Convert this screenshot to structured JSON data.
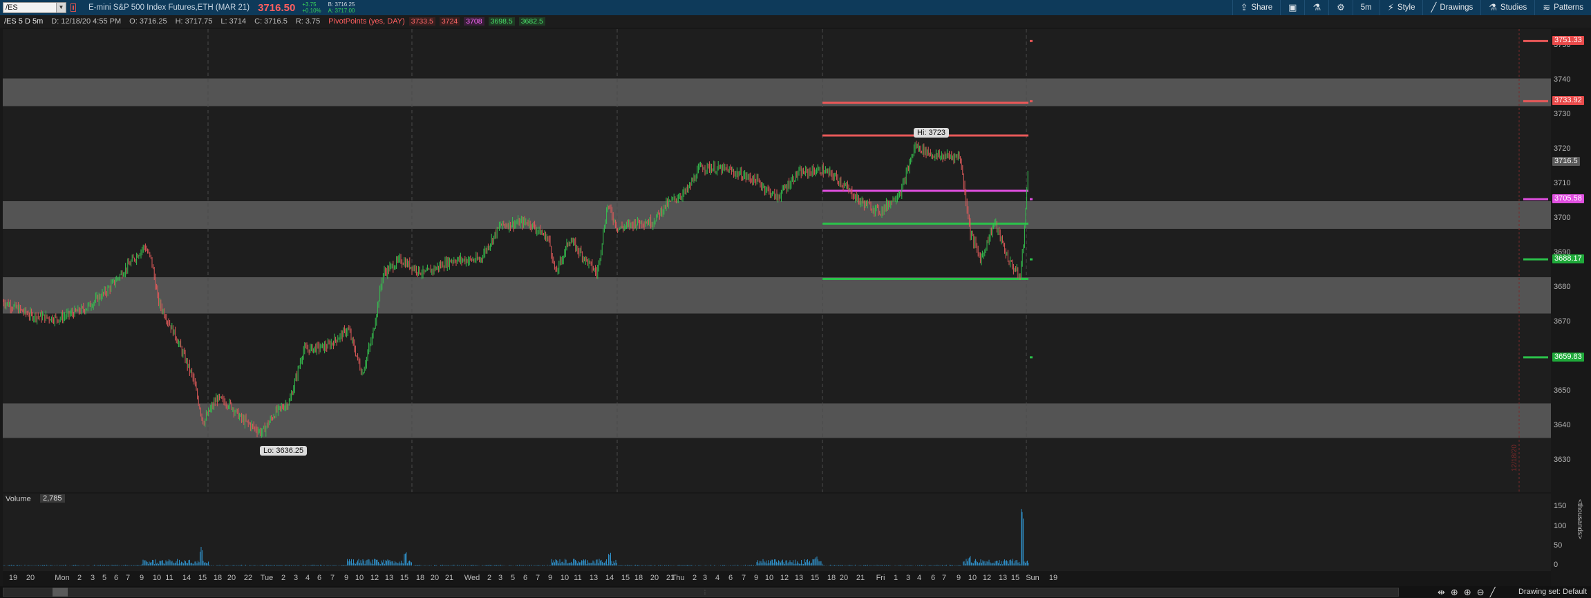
{
  "toolbar": {
    "symbol": "/ES",
    "instrument": "E-mini S&P 500 Index Futures,ETH (MAR 21)",
    "last_price": "3716.50",
    "change": "+3.75",
    "change_pct": "+0.10%",
    "bid": "B: 3716.25",
    "ask": "A: 3717.00",
    "buttons": [
      {
        "label": "Share",
        "icon": "share-icon"
      },
      {
        "label": "",
        "icon": "screenshot-icon"
      },
      {
        "label": "",
        "icon": "flask-icon"
      },
      {
        "label": "",
        "icon": "gear-icon"
      },
      {
        "label": "5m",
        "icon": ""
      },
      {
        "label": "Style",
        "icon": "style-icon"
      },
      {
        "label": "Drawings",
        "icon": "pencil-icon"
      },
      {
        "label": "Studies",
        "icon": "flask-icon"
      },
      {
        "label": "Patterns",
        "icon": "patterns-icon"
      }
    ]
  },
  "info": {
    "symbol_tf": "/ES 5 D 5m",
    "date": "D: 12/18/20 4:55 PM",
    "open": "O: 3716.25",
    "high": "H: 3717.75",
    "low": "L: 3714",
    "close": "C: 3716.5",
    "range": "R: 3.75",
    "pivot_label": "PivotPoints (yes, DAY)",
    "pivot_values": [
      {
        "value": "3733.5",
        "color": "#ff5f5f"
      },
      {
        "value": "3724",
        "color": "#ff5f5f"
      },
      {
        "value": "3708",
        "color": "#ff5cff"
      },
      {
        "value": "3698.5",
        "color": "#3bd55b"
      },
      {
        "value": "3682.5",
        "color": "#3bd55b"
      }
    ]
  },
  "chart": {
    "y_ticks": [
      "3750",
      "3740",
      "3730",
      "3720",
      "3710",
      "3700",
      "3690",
      "3680",
      "3670",
      "3660",
      "3650",
      "3640",
      "3630"
    ],
    "price_tags": [
      {
        "value": "3751.33",
        "color": "#e84a4a"
      },
      {
        "value": "3733.92",
        "color": "#e84a4a"
      },
      {
        "value": "3716.5",
        "color": "#5a5a5a"
      },
      {
        "value": "3705.58",
        "color": "#e04fe0"
      },
      {
        "value": "3688.17",
        "color": "#1faa3a"
      },
      {
        "value": "3659.83",
        "color": "#1faa3a"
      }
    ],
    "hi_label": "Hi: 3723",
    "lo_label": "Lo: 3636.25",
    "zones": [
      {
        "from": 3732.5,
        "to": 3740.5
      },
      {
        "from": 3697,
        "to": 3705
      },
      {
        "from": 3672.5,
        "to": 3683
      },
      {
        "from": 3636.5,
        "to": 3646.5
      }
    ],
    "pivot_lines": [
      {
        "value": 3733.5,
        "color": "#e85858"
      },
      {
        "value": 3724,
        "color": "#e85858"
      },
      {
        "value": 3708,
        "color": "#e04fe0"
      },
      {
        "value": 3698.5,
        "color": "#2bc24a"
      },
      {
        "value": 3682.5,
        "color": "#2bc24a"
      }
    ],
    "timestamp": "12/18/20"
  },
  "volume": {
    "label": "Volume",
    "value": "2,785",
    "ticks": [
      "150",
      "100",
      "50",
      "0"
    ],
    "unit": "<thousands>"
  },
  "x_ticks": [
    "19",
    "20",
    "Mon",
    "2",
    "3",
    "5",
    "6",
    "7",
    "9",
    "10",
    "11",
    "14",
    "15",
    "18",
    "20",
    "22",
    "Tue",
    "2",
    "3",
    "4",
    "6",
    "7",
    "9",
    "10",
    "12",
    "13",
    "15",
    "18",
    "20",
    "21",
    "Wed",
    "2",
    "3",
    "5",
    "6",
    "7",
    "9",
    "10",
    "11",
    "13",
    "14",
    "15",
    "18",
    "20",
    "21",
    "Thu",
    "2",
    "3",
    "4",
    "6",
    "7",
    "9",
    "10",
    "12",
    "13",
    "15",
    "18",
    "20",
    "21",
    "Fri",
    "1",
    "3",
    "4",
    "6",
    "7",
    "9",
    "10",
    "12",
    "13",
    "15",
    "Sun",
    "19"
  ],
  "footer": {
    "drawing_set": "Drawing set: Default"
  }
}
